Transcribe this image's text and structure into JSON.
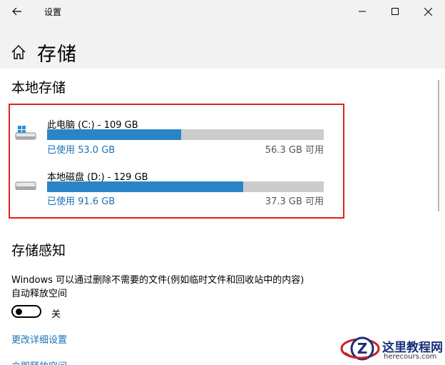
{
  "window": {
    "app_title": "设置"
  },
  "header": {
    "page_title": "存储"
  },
  "local_storage": {
    "section_title": "本地存储",
    "drives": [
      {
        "name": "此电脑 (C:) - 109 GB",
        "used": "已使用 53.0 GB",
        "free": "56.3 GB 可用",
        "used_fraction": 0.485,
        "icon": "windows-drive-icon"
      },
      {
        "name": "本地磁盘 (D:) - 129 GB",
        "used": "已使用 91.6 GB",
        "free": "37.3 GB 可用",
        "used_fraction": 0.71,
        "icon": "hard-drive-icon"
      }
    ]
  },
  "storage_sense": {
    "section_title": "存储感知",
    "description_line1": "Windows 可以通过删除不需要的文件(例如临时文件和回收站中的内容)",
    "description_line2": "自动释放空间",
    "toggle_state": "关",
    "toggle_on": false,
    "link_details": "更改详细设置",
    "link_free_now": "立即释放空间"
  },
  "watermark": {
    "title": "这里教程网",
    "url": "herecours.com"
  },
  "colors": {
    "accent": "#2a85c7",
    "link": "#1a72b5",
    "highlight_border": "#e02020",
    "titlebar_bg": "#f2f2f2"
  }
}
